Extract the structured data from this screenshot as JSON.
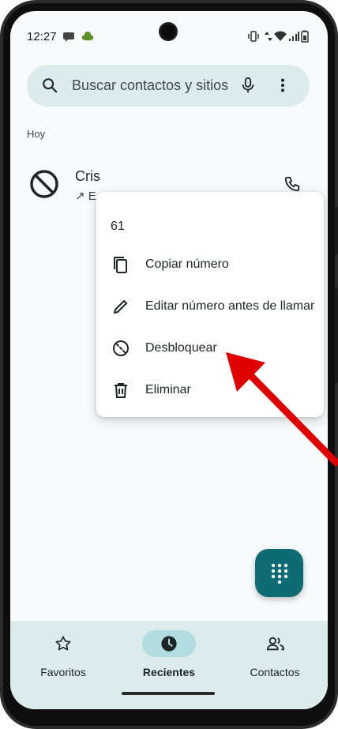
{
  "status_bar": {
    "time": "12:27"
  },
  "search": {
    "placeholder": "Buscar contactos y sitios"
  },
  "recents": {
    "section_label": "Hoy",
    "calls": [
      {
        "name": "Cris",
        "meta": "↗ E"
      }
    ]
  },
  "context_menu": {
    "number": "61",
    "items": [
      {
        "label": "Copiar número",
        "icon": "copy-icon"
      },
      {
        "label": "Editar número antes de llamar",
        "icon": "pencil-icon"
      },
      {
        "label": "Desbloquear",
        "icon": "unblock-icon"
      },
      {
        "label": "Eliminar",
        "icon": "trash-icon"
      }
    ]
  },
  "bottom_nav": {
    "items": [
      {
        "label": "Favoritos",
        "icon": "star-icon",
        "active": false
      },
      {
        "label": "Recientes",
        "icon": "clock-icon",
        "active": true
      },
      {
        "label": "Contactos",
        "icon": "people-icon",
        "active": false
      }
    ]
  },
  "colors": {
    "accent": "#0f6b73",
    "surface": "#f7fbfb",
    "search_bg": "#dcebec",
    "annotation_arrow": "#e00000"
  }
}
